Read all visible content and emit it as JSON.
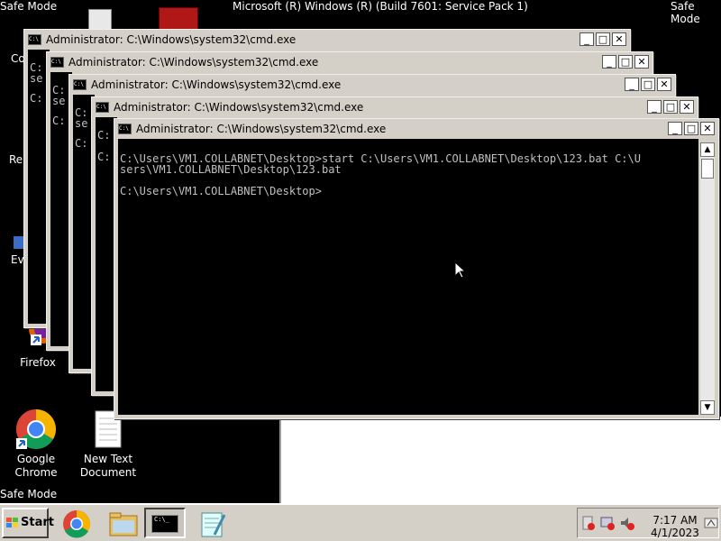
{
  "screen": {
    "top_title": "Microsoft (R) Windows (R) (Build 7601: Service Pack 1)",
    "safe_mode_label": "Safe Mode"
  },
  "desktop_icons": {
    "firefox": "Firefox",
    "chrome_line1": "Google",
    "chrome_line2": "Chrome",
    "textdoc_line1": "New Text",
    "textdoc_line2": "Document",
    "partial_co": "Co",
    "partial_re": "Re",
    "partial_ev": "Ev"
  },
  "windows": {
    "title": "Administrator: C:\\Windows\\system32\\cmd.exe",
    "partial_c": "C:",
    "partial_se": "se",
    "active_line1": "C:\\Users\\VM1.COLLABNET\\Desktop>start C:\\Users\\VM1.COLLABNET\\Desktop\\123.bat C:\\U",
    "active_line2": "sers\\VM1.COLLABNET\\Desktop\\123.bat",
    "active_prompt": "C:\\Users\\VM1.COLLABNET\\Desktop>"
  },
  "taskbar": {
    "start_label": "Start",
    "time": "7:17 AM",
    "date": "4/1/2023"
  },
  "colors": {
    "console_bg": "#000000",
    "console_fg": "#c0c0c0",
    "chrome_frame": "#d4d0c8"
  }
}
